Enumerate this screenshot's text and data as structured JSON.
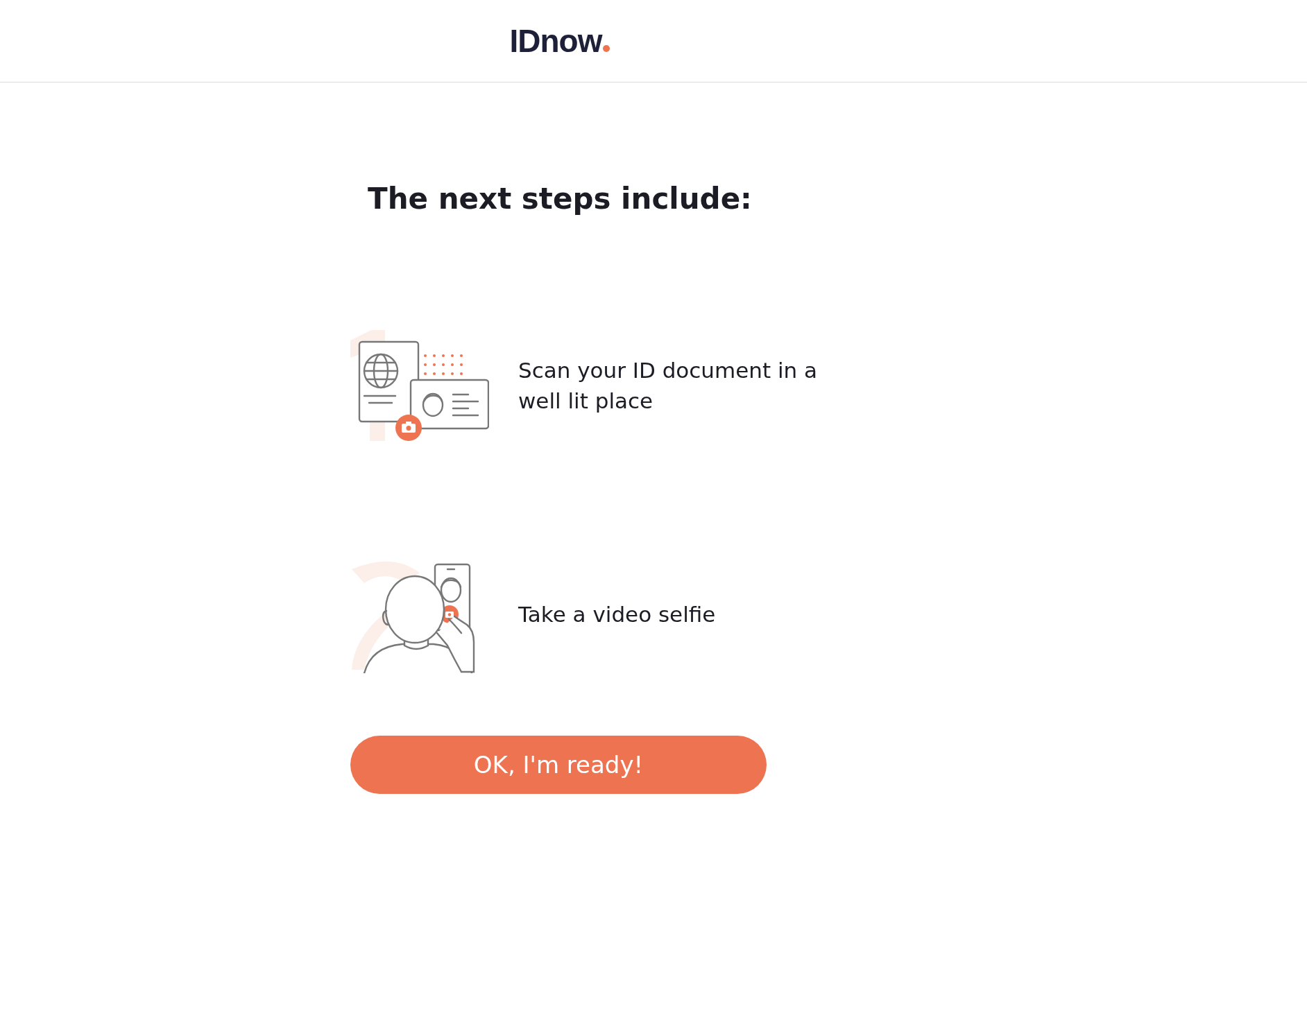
{
  "header": {
    "logo": "IDnow"
  },
  "heading": "The next steps include:",
  "steps": [
    {
      "kind": "document",
      "text": "Scan your ID document in a well lit place"
    },
    {
      "kind": "selfie",
      "text": "Take a video selfie"
    }
  ],
  "button": "OK, I'm ready!"
}
